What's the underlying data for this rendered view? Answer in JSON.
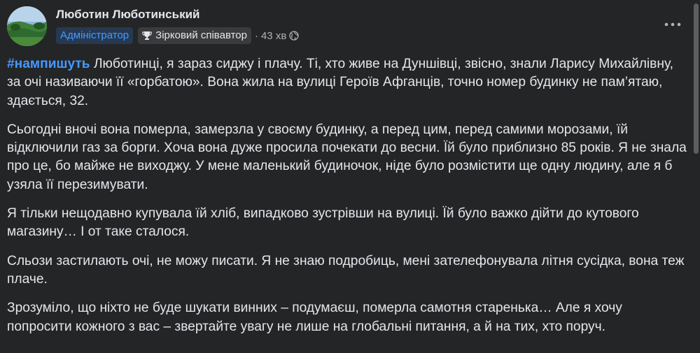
{
  "author": {
    "name": "Люботин Люботинський",
    "avatar_icon": "landscape-avatar-icon"
  },
  "meta": {
    "admin_badge": "Адміністратор",
    "star_badge": "Зірковий співавтор",
    "star_icon": "trophy-icon",
    "separator": "·",
    "time": "43 хв",
    "privacy_icon": "globe-icon"
  },
  "actions": {
    "more_icon": "more-options-icon"
  },
  "post": {
    "hashtag": "#нампишуть",
    "p1_rest": " Люботинці, я зараз сиджу і плачу. Ті, хто живе на Дуншівці, звісно, знали Ларису Михайлівну, за очі називаючи її «горбатою». Вона жила на вулиці Героїв Афганців, точно номер будинку не пам’ятаю, здається, 32.",
    "p2": "Сьогодні вночі вона померла, замерзла у своєму будинку, а перед цим, перед самими морозами, їй відключили газ за борги. Хоча вона дуже просила почекати до весни. Їй було приблизно 85 років. Я не знала про це, бо майже не виходжу. У мене маленький будиночок, ніде було розмістити ще одну людину, але я б узяла її перезимувати.",
    "p3": "Я тільки нещодавно купувала їй хліб, випадково зустрівши на вулиці. Їй було важко дійти до кутового магазину… І от таке сталося.",
    "p4": "Сльози застилають очі, не можу писати. Я не знаю подробиць, мені зателефонувала літня сусідка, вона теж плаче.",
    "p5": "Зрозуміло, що ніхто не буде шукати винних – подумаєш, померла самотня старенька… Але я хочу попросити кожного з вас – звертайте увагу не лише на глобальні питання, а й на тих, хто поруч."
  },
  "colors": {
    "background": "#242526",
    "text": "#e4e6eb",
    "secondary_text": "#b0b3b8",
    "accent": "#4599ff",
    "admin_badge_bg": "#263951",
    "star_badge_bg": "#3a3b3c"
  }
}
